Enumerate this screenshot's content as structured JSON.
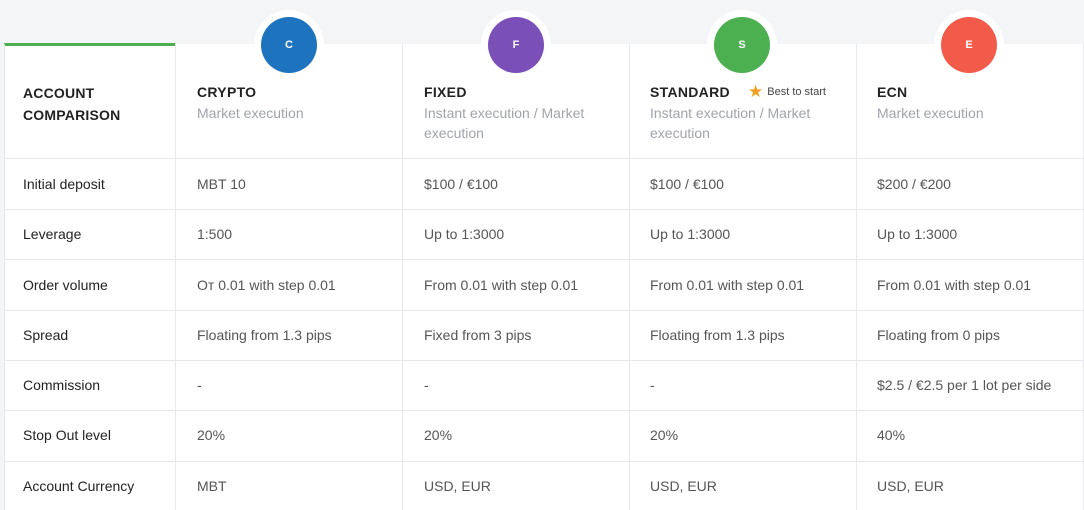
{
  "header": {
    "title": "ACCOUNT COMPARISON"
  },
  "columns": [
    {
      "badge": "C",
      "name": "CRYPTO",
      "execution": "Market execution",
      "color": "#1e73be"
    },
    {
      "badge": "F",
      "name": "FIXED",
      "execution": "Instant execution / Market execution",
      "color": "#7a4fb8"
    },
    {
      "badge": "S",
      "name": "STANDARD",
      "execution": "Instant execution / Market execution",
      "color": "#4caf50",
      "tag": "Best to start"
    },
    {
      "badge": "E",
      "name": "ECN",
      "execution": "Market execution",
      "color": "#f25a4a"
    }
  ],
  "rows": [
    {
      "label": "Initial deposit",
      "values": [
        "MBT 10",
        "$100 / €100",
        "$100 / €100",
        "$200 / €200"
      ]
    },
    {
      "label": "Leverage",
      "values": [
        "1:500",
        "Up to 1:3000",
        "Up to 1:3000",
        "Up to 1:3000"
      ]
    },
    {
      "label": "Order volume",
      "values": [
        "От 0.01 with step 0.01",
        "From 0.01 with step 0.01",
        "From 0.01 with step 0.01",
        "From 0.01 with step 0.01"
      ]
    },
    {
      "label": "Spread",
      "values": [
        "Floating from 1.3 pips",
        "Fixed from 3 pips",
        "Floating from 1.3 pips",
        "Floating from 0 pips"
      ]
    },
    {
      "label": "Commission",
      "values": [
        "-",
        "-",
        "-",
        "$2.5 / €2.5 per 1 lot per side"
      ]
    },
    {
      "label": "Stop Out level",
      "values": [
        "20%",
        "20%",
        "20%",
        "40%"
      ]
    },
    {
      "label": "Account Currency",
      "values": [
        "MBT",
        "USD, EUR",
        "USD, EUR",
        "USD, EUR"
      ]
    }
  ],
  "icons": {
    "best": "star-icon"
  }
}
